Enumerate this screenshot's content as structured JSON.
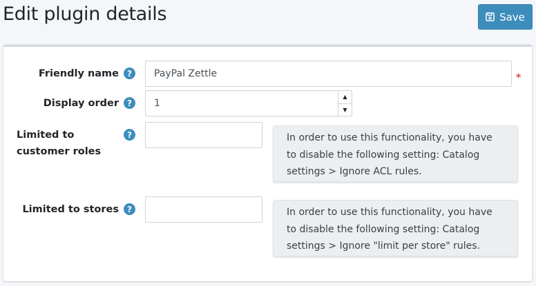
{
  "header": {
    "title": "Edit plugin details",
    "save_label": "Save"
  },
  "form": {
    "friendly_name": {
      "label": "Friendly name",
      "value": "PayPal Zettle",
      "required_mark": "*"
    },
    "display_order": {
      "label": "Display order",
      "value": "1"
    },
    "customer_roles": {
      "label": "Limited to customer roles",
      "value": "",
      "note": "In order to use this functionality, you have to disable the following setting: Catalog settings > Ignore ACL rules."
    },
    "stores": {
      "label": "Limited to stores",
      "value": "",
      "note": "In order to use this functionality, you have to disable the following setting: Catalog settings > Ignore \"limit per store\" rules."
    }
  },
  "icons": {
    "help": "question-circle-icon",
    "save": "floppy-disk-icon",
    "spinner_up": "triangle-up-icon",
    "spinner_down": "triangle-down-icon"
  },
  "colors": {
    "primary": "#3c8dbc",
    "required": "#dd4b39",
    "callout_bg": "#eceef1"
  }
}
